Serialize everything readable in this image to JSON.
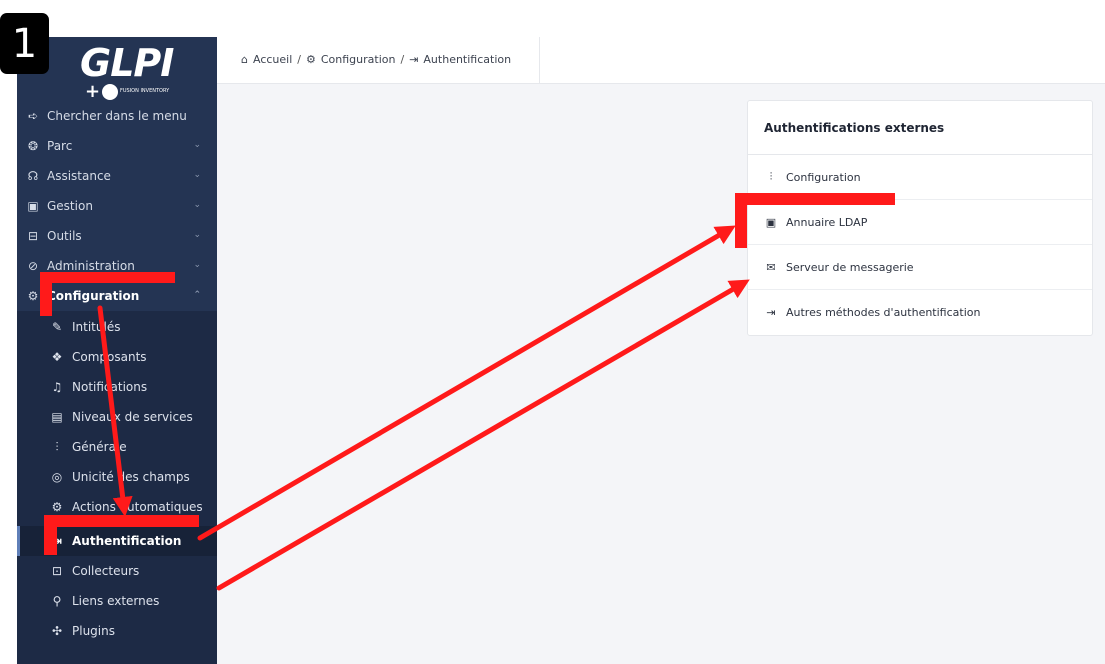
{
  "step_badge": "1",
  "logo": {
    "name": "GLPI",
    "plus": "+",
    "addon": "FUSION INVENTORY"
  },
  "sidebar": {
    "search_label": "Chercher dans le menu",
    "items": [
      {
        "label": "Parc",
        "icon": "cube-icon"
      },
      {
        "label": "Assistance",
        "icon": "headset-icon"
      },
      {
        "label": "Gestion",
        "icon": "wallet-icon"
      },
      {
        "label": "Outils",
        "icon": "briefcase-icon"
      },
      {
        "label": "Administration",
        "icon": "shield-check-icon"
      },
      {
        "label": "Configuration",
        "icon": "gear-icon"
      }
    ],
    "sub_items": [
      {
        "label": "Intitulés",
        "icon": "edit-icon"
      },
      {
        "label": "Composants",
        "icon": "components-icon"
      },
      {
        "label": "Notifications",
        "icon": "bell-icon"
      },
      {
        "label": "Niveaux de services",
        "icon": "clipboard-icon"
      },
      {
        "label": "Générale",
        "icon": "sliders-icon"
      },
      {
        "label": "Unicité des champs",
        "icon": "fingerprint-icon"
      },
      {
        "label": "Actions automatiques",
        "icon": "settings-automation-icon"
      },
      {
        "label": "Authentification",
        "icon": "login-icon"
      },
      {
        "label": "Collecteurs",
        "icon": "inbox-icon"
      },
      {
        "label": "Liens externes",
        "icon": "link-icon"
      },
      {
        "label": "Plugins",
        "icon": "puzzle-icon"
      }
    ]
  },
  "breadcrumb": {
    "home": "Accueil",
    "config": "Configuration",
    "auth": "Authentification",
    "separator": "/"
  },
  "card": {
    "title": "Authentifications externes",
    "rows": [
      {
        "label": "Configuration",
        "icon": "sliders-icon"
      },
      {
        "label": "Annuaire LDAP",
        "icon": "address-book-icon"
      },
      {
        "label": "Serveur de messagerie",
        "icon": "mail-icon"
      },
      {
        "label": "Autres méthodes d'authentification",
        "icon": "login-icon"
      }
    ]
  },
  "colors": {
    "sidebar_bg": "#243453",
    "annotation": "#ff1a1a",
    "main_bg": "#f4f5f8"
  }
}
